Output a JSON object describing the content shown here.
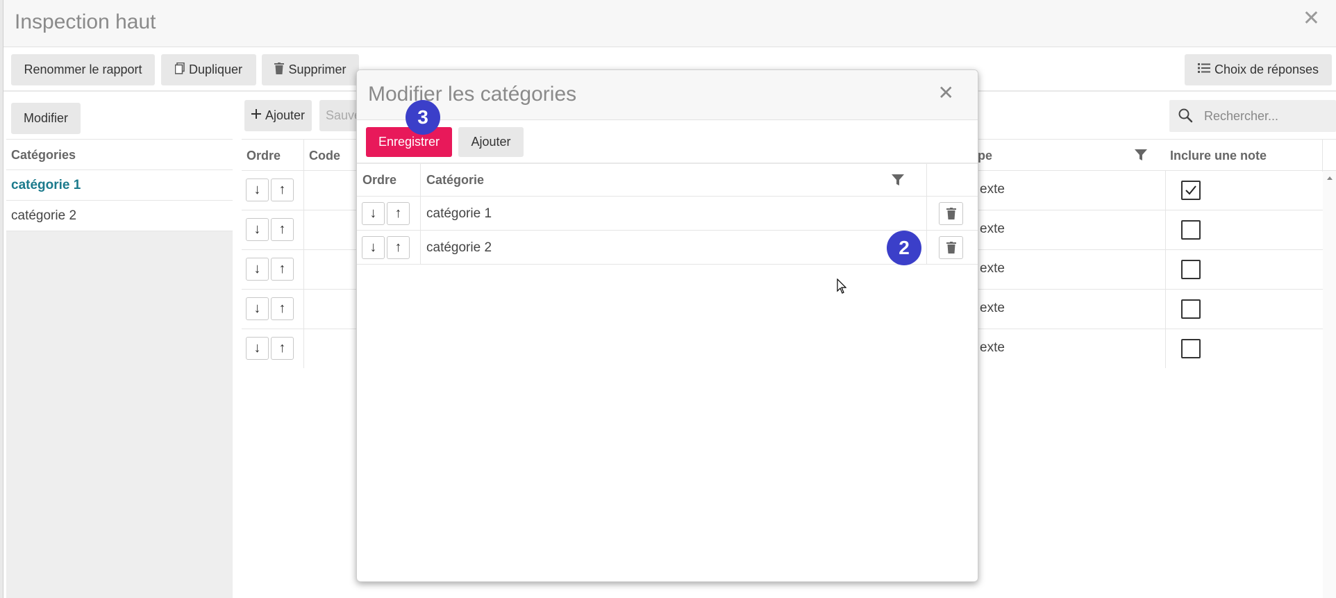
{
  "window": {
    "title": "Inspection haut"
  },
  "toolbar": {
    "rename_label": "Renommer le rapport",
    "duplicate_label": "Dupliquer",
    "delete_label": "Supprimer",
    "answers_label": "Choix de réponses"
  },
  "left_panel": {
    "modify_label": "Modifier",
    "header": "Catégories",
    "items": [
      {
        "label": "catégorie 1",
        "active": true
      },
      {
        "label": "catégorie 2",
        "active": false
      }
    ]
  },
  "grid": {
    "add_label": "Ajouter",
    "save_label": "Sauve",
    "search_placeholder": "Rechercher...",
    "columns": {
      "order": "Ordre",
      "code": "Code",
      "type": "pe",
      "note": "Inclure une note"
    },
    "rows": [
      {
        "type": "exte",
        "note": true
      },
      {
        "type": "exte",
        "note": false
      },
      {
        "type": "exte",
        "note": false
      },
      {
        "type": "exte",
        "note": false
      },
      {
        "type": "exte",
        "note": false
      }
    ]
  },
  "modal": {
    "title": "Modifier les catégories",
    "save_label": "Enregistrer",
    "add_label": "Ajouter",
    "columns": {
      "order": "Ordre",
      "category": "Catégorie"
    },
    "rows": [
      {
        "category": "catégorie 1"
      },
      {
        "category": "catégorie 2"
      }
    ]
  },
  "badges": {
    "step_save": "3",
    "step_row": "2"
  },
  "colors": {
    "primary": "#e8195a",
    "badge": "#3b3fc9",
    "active_link": "#1b7a8c"
  },
  "icons": {
    "close": "close-icon",
    "copy": "copy-icon",
    "trash": "trash-icon",
    "list": "list-icon",
    "plus": "plus-icon",
    "search": "search-icon",
    "filter": "filter-icon",
    "arrow_down": "arrow-down-icon",
    "arrow_up": "arrow-up-icon",
    "checkbox": "checkbox"
  }
}
